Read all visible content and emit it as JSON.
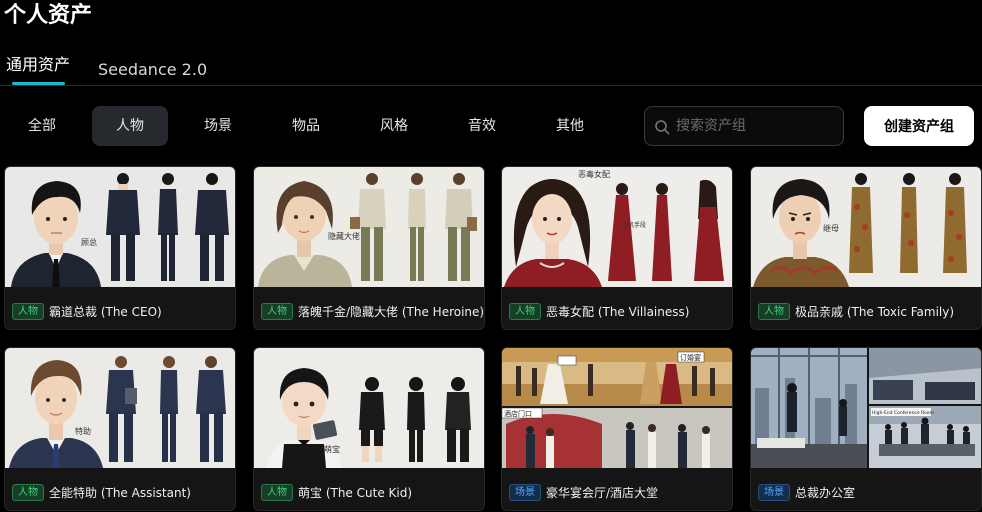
{
  "header": {
    "title": "个人资产"
  },
  "tabs": [
    {
      "label": "通用资产",
      "active": true
    },
    {
      "label": "Seedance 2.0",
      "active": false
    }
  ],
  "filters": [
    "全部",
    "人物",
    "场景",
    "物品",
    "风格",
    "音效",
    "其他"
  ],
  "active_filter": "人物",
  "search": {
    "placeholder": "搜索资产组"
  },
  "create_button": "创建资产组",
  "colors": {
    "accent": "#1fb6c9",
    "person_badge": "#42d07d",
    "scene_badge": "#59a4ff"
  },
  "cards": [
    {
      "badge": "人物",
      "title": "霸道总裁 (The CEO)",
      "thumb_labels": [
        "顾总"
      ]
    },
    {
      "badge": "人物",
      "title": "落魄千金/隐藏大佬 (The Heroine)",
      "thumb_labels": [
        "隐藏大佬"
      ]
    },
    {
      "badge": "人物",
      "title": "恶毒女配 (The Villainess)",
      "thumb_labels": [
        "恶毒女配",
        "心机手段"
      ]
    },
    {
      "badge": "人物",
      "title": "极品亲戚 (The Toxic Family)",
      "thumb_labels": [
        "继母"
      ]
    },
    {
      "badge": "人物",
      "title": "全能特助 (The Assistant)",
      "thumb_labels": [
        "特助"
      ]
    },
    {
      "badge": "人物",
      "title": "萌宝 (The Cute Kid)",
      "thumb_labels": [
        "萌宝"
      ]
    },
    {
      "badge": "场景",
      "title": "豪华宴会厅/酒店大堂",
      "thumb_labels": [
        "订婚宴",
        "酒店门口"
      ]
    },
    {
      "badge": "场景",
      "title": "总裁办公室",
      "thumb_labels": [
        "High-End Conference Room"
      ]
    }
  ]
}
